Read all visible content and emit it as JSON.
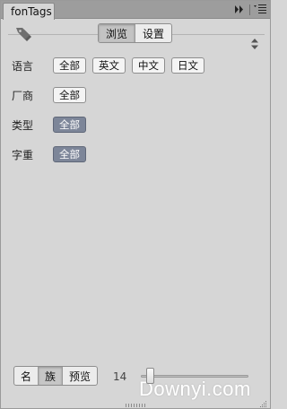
{
  "panel": {
    "title": "fonTags",
    "collapse_icon": "double-chevron-right-icon",
    "menu_icon": "panel-menu-icon"
  },
  "header": {
    "tag_icon": "tag-icon",
    "tabs": [
      {
        "label": "浏览",
        "active": true
      },
      {
        "label": "设置",
        "active": false
      }
    ],
    "sort_icon": "sort-arrows-icon"
  },
  "filters": [
    {
      "label": "语言",
      "chips": [
        {
          "label": "全部",
          "selected": false
        },
        {
          "label": "英文",
          "selected": false
        },
        {
          "label": "中文",
          "selected": false
        },
        {
          "label": "日文",
          "selected": false
        }
      ]
    },
    {
      "label": "厂商",
      "chips": [
        {
          "label": "全部",
          "selected": false
        }
      ]
    },
    {
      "label": "类型",
      "chips": [
        {
          "label": "全部",
          "selected": true
        }
      ]
    },
    {
      "label": "字重",
      "chips": [
        {
          "label": "全部",
          "selected": true
        }
      ]
    }
  ],
  "bottom": {
    "view_tabs": [
      {
        "label": "名",
        "active": false
      },
      {
        "label": "族",
        "active": true
      },
      {
        "label": "预览",
        "active": false
      }
    ],
    "size_value": "14",
    "slider_level": 0.05
  },
  "watermark": "Downyi.com",
  "colors": {
    "panel_bg": "#d6d6d6",
    "titlebar_bg": "#9d9d9d",
    "chip_selected": "#7d8699"
  }
}
